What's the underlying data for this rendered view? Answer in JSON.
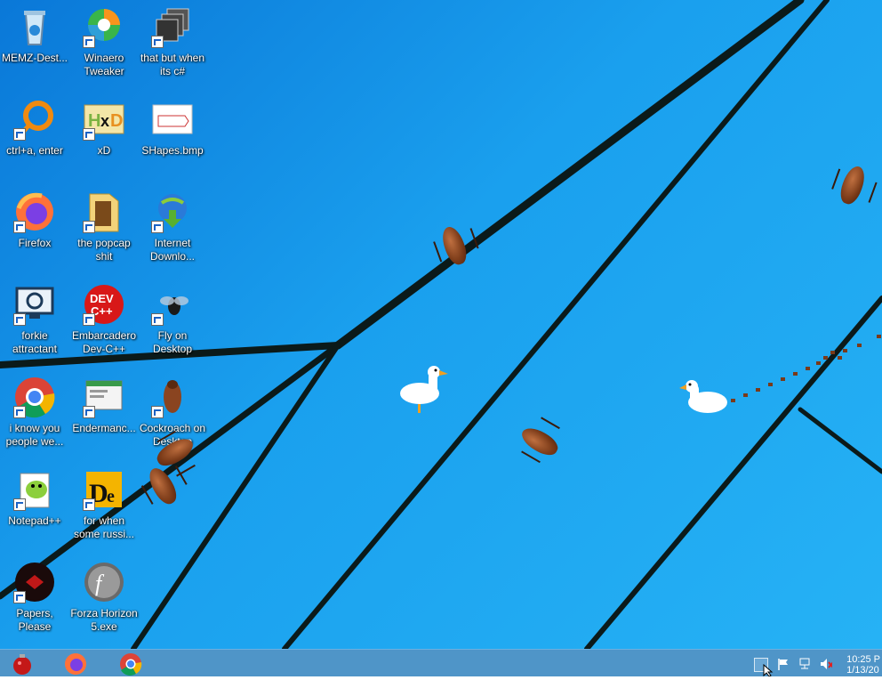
{
  "desktop": {
    "icons": [
      {
        "label": "MEMZ-Dest...",
        "name": "recycle-bin-icon"
      },
      {
        "label": "Winaero Tweaker",
        "name": "winaero-icon"
      },
      {
        "label": "that but when its c#",
        "name": "stack-icon"
      },
      {
        "label": "ctrl+a, enter",
        "name": "ring-icon"
      },
      {
        "label": "xD",
        "name": "hxd-icon"
      },
      {
        "label": "SHapes.bmp",
        "name": "bitmap-icon"
      },
      {
        "label": "Firefox",
        "name": "firefox-icon"
      },
      {
        "label": "the popcap shit",
        "name": "folder-icon"
      },
      {
        "label": "Internet Downlo...",
        "name": "globe-download-icon"
      },
      {
        "label": "forkie attractant",
        "name": "monitor-gear-icon"
      },
      {
        "label": "Embarcadero Dev-C++",
        "name": "devcpp-icon"
      },
      {
        "label": "Fly on Desktop",
        "name": "fly-icon"
      },
      {
        "label": "i know you people we...",
        "name": "chrome-icon"
      },
      {
        "label": "Endermanc...",
        "name": "window-app-icon"
      },
      {
        "label": "Cockroach on Desktop",
        "name": "cockroach-icon"
      },
      {
        "label": "Notepad++",
        "name": "notepadpp-icon"
      },
      {
        "label": "for when some russi...",
        "name": "de-icon"
      },
      {
        "label": "Papers, Please",
        "name": "papers-please-icon"
      },
      {
        "label": "Forza Horizon 5.exe",
        "name": "flash-icon"
      }
    ]
  },
  "taskbar": {
    "apps": [
      "ornament-icon",
      "firefox-icon",
      "chrome-icon"
    ],
    "tray": [
      "show-hidden-icon",
      "flag-icon",
      "network-icon",
      "volume-muted-icon"
    ],
    "clock": {
      "time": "10:25 P",
      "date": "1/13/20"
    }
  },
  "colors": {
    "taskbar": "#4f95c8",
    "wallpaper": "#1aa0ee",
    "lines": "#0b1a1a"
  }
}
